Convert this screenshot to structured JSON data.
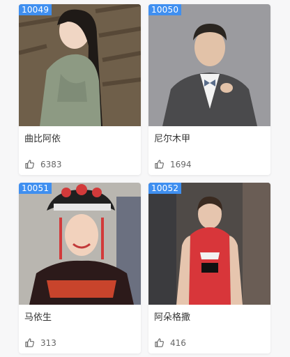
{
  "cards": [
    {
      "id": "10049",
      "name": "曲比阿依",
      "likes": "6383"
    },
    {
      "id": "10050",
      "name": "尼尔木甲",
      "likes": "1694"
    },
    {
      "id": "10051",
      "name": "马依生",
      "likes": "313"
    },
    {
      "id": "10052",
      "name": "阿朵格撒",
      "likes": "416"
    }
  ],
  "colors": {
    "badge": "#3f8ff0",
    "card_bg": "#ffffff",
    "page_bg": "#f7f7f8"
  },
  "icons": {
    "like": "thumbs-up-icon"
  }
}
